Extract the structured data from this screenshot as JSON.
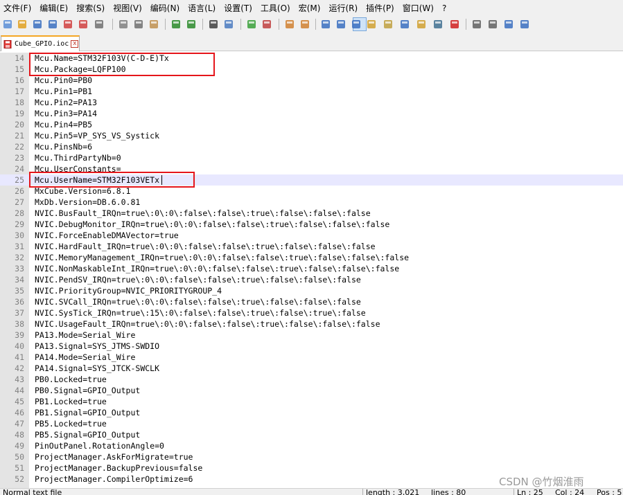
{
  "menu": [
    "文件(F)",
    "编辑(E)",
    "搜索(S)",
    "视图(V)",
    "编码(N)",
    "语言(L)",
    "设置(T)",
    "工具(O)",
    "宏(M)",
    "运行(R)",
    "插件(P)",
    "窗口(W)",
    "?"
  ],
  "toolbar_icons": [
    "new-file-icon",
    "open-file-icon",
    "save-icon",
    "save-all-icon",
    "close-icon",
    "close-all-icon",
    "print-icon",
    "cut-icon",
    "copy-icon",
    "paste-icon",
    "undo-icon",
    "redo-icon",
    "find-icon",
    "replace-icon",
    "zoom-in-icon",
    "zoom-out-icon",
    "sync-vertical-icon",
    "sync-horizontal-icon",
    "word-wrap-icon",
    "show-all-chars-icon",
    "indent-guide-icon",
    "user-language-icon",
    "document-map-icon",
    "function-list-icon",
    "folder-workspace-icon",
    "monitoring-icon",
    "record-macro-icon",
    "stop-macro-icon",
    "play-macro-icon",
    "run-macro-multiple-icon",
    "save-macro-icon"
  ],
  "tab": {
    "label": "Cube_GPIO.ioc",
    "close": "x"
  },
  "lines": [
    {
      "n": "14",
      "t": "Mcu.Name=STM32F103V(C-D-E)Tx"
    },
    {
      "n": "15",
      "t": "Mcu.Package=LQFP100"
    },
    {
      "n": "16",
      "t": "Mcu.Pin0=PB0"
    },
    {
      "n": "17",
      "t": "Mcu.Pin1=PB1"
    },
    {
      "n": "18",
      "t": "Mcu.Pin2=PA13"
    },
    {
      "n": "19",
      "t": "Mcu.Pin3=PA14"
    },
    {
      "n": "20",
      "t": "Mcu.Pin4=PB5"
    },
    {
      "n": "21",
      "t": "Mcu.Pin5=VP_SYS_VS_Systick"
    },
    {
      "n": "22",
      "t": "Mcu.PinsNb=6"
    },
    {
      "n": "23",
      "t": "Mcu.ThirdPartyNb=0"
    },
    {
      "n": "24",
      "t": "Mcu.UserConstants="
    },
    {
      "n": "25",
      "t": "Mcu.UserName=STM32F103VETx"
    },
    {
      "n": "26",
      "t": "MxCube.Version=6.8.1"
    },
    {
      "n": "27",
      "t": "MxDb.Version=DB.6.0.81"
    },
    {
      "n": "28",
      "t": "NVIC.BusFault_IRQn=true\\:0\\:0\\:false\\:false\\:true\\:false\\:false\\:false"
    },
    {
      "n": "29",
      "t": "NVIC.DebugMonitor_IRQn=true\\:0\\:0\\:false\\:false\\:true\\:false\\:false\\:false"
    },
    {
      "n": "30",
      "t": "NVIC.ForceEnableDMAVector=true"
    },
    {
      "n": "31",
      "t": "NVIC.HardFault_IRQn=true\\:0\\:0\\:false\\:false\\:true\\:false\\:false\\:false"
    },
    {
      "n": "32",
      "t": "NVIC.MemoryManagement_IRQn=true\\:0\\:0\\:false\\:false\\:true\\:false\\:false\\:false"
    },
    {
      "n": "33",
      "t": "NVIC.NonMaskableInt_IRQn=true\\:0\\:0\\:false\\:false\\:true\\:false\\:false\\:false"
    },
    {
      "n": "34",
      "t": "NVIC.PendSV_IRQn=true\\:0\\:0\\:false\\:false\\:true\\:false\\:false\\:false"
    },
    {
      "n": "35",
      "t": "NVIC.PriorityGroup=NVIC_PRIORITYGROUP_4"
    },
    {
      "n": "36",
      "t": "NVIC.SVCall_IRQn=true\\:0\\:0\\:false\\:false\\:true\\:false\\:false\\:false"
    },
    {
      "n": "37",
      "t": "NVIC.SysTick_IRQn=true\\:15\\:0\\:false\\:false\\:true\\:false\\:true\\:false"
    },
    {
      "n": "38",
      "t": "NVIC.UsageFault_IRQn=true\\:0\\:0\\:false\\:false\\:true\\:false\\:false\\:false"
    },
    {
      "n": "39",
      "t": "PA13.Mode=Serial_Wire"
    },
    {
      "n": "40",
      "t": "PA13.Signal=SYS_JTMS-SWDIO"
    },
    {
      "n": "41",
      "t": "PA14.Mode=Serial_Wire"
    },
    {
      "n": "42",
      "t": "PA14.Signal=SYS_JTCK-SWCLK"
    },
    {
      "n": "43",
      "t": "PB0.Locked=true"
    },
    {
      "n": "44",
      "t": "PB0.Signal=GPIO_Output"
    },
    {
      "n": "45",
      "t": "PB1.Locked=true"
    },
    {
      "n": "46",
      "t": "PB1.Signal=GPIO_Output"
    },
    {
      "n": "47",
      "t": "PB5.Locked=true"
    },
    {
      "n": "48",
      "t": "PB5.Signal=GPIO_Output"
    },
    {
      "n": "49",
      "t": "PinOutPanel.RotationAngle=0"
    },
    {
      "n": "50",
      "t": "ProjectManager.AskForMigrate=true"
    },
    {
      "n": "51",
      "t": "ProjectManager.BackupPrevious=false"
    },
    {
      "n": "52",
      "t": "ProjectManager.CompilerOptimize=6"
    }
  ],
  "current_line": "25",
  "status": {
    "filetype": "Normal text file",
    "length": "length : 3,021",
    "lines": "lines : 80",
    "position": "Ln : 25",
    "col": "Col : 24",
    "pos": "Pos : 5"
  },
  "watermark": "CSDN @竹烟淮雨"
}
